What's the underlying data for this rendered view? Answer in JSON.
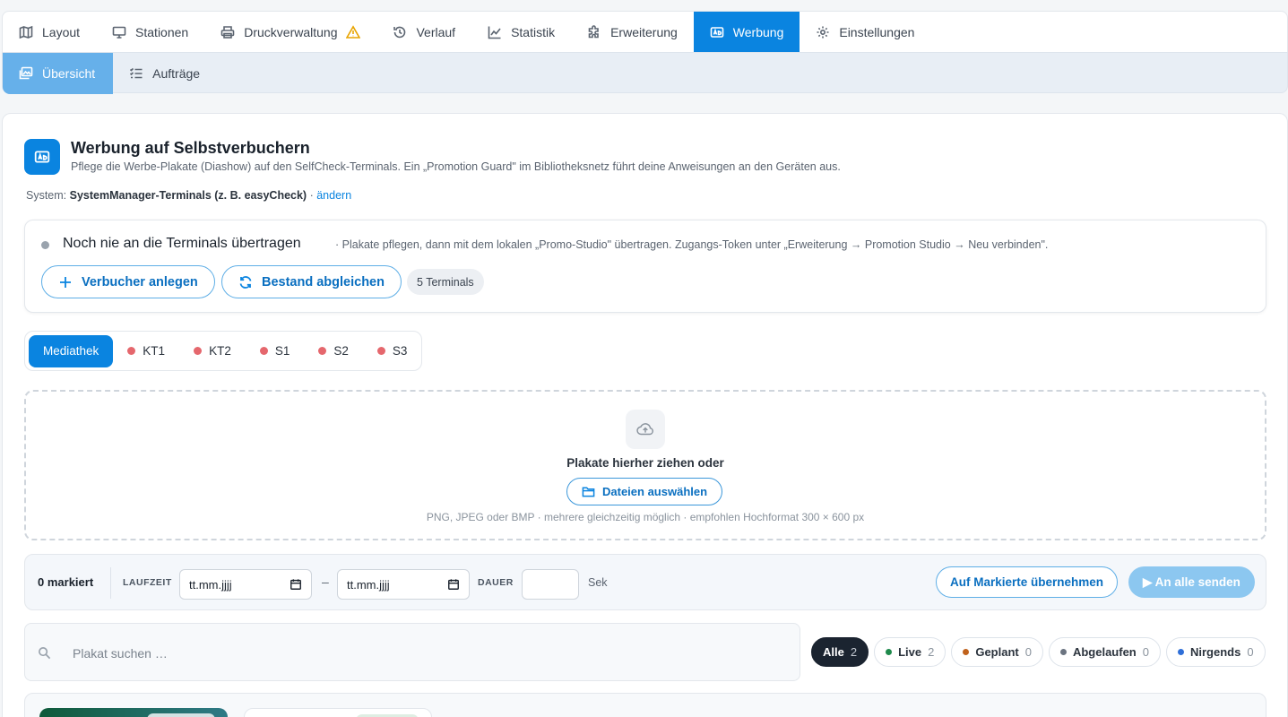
{
  "topnav": {
    "tabs": [
      {
        "label": "Layout",
        "icon": "map-icon"
      },
      {
        "label": "Stationen",
        "icon": "monitor-icon"
      },
      {
        "label": "Druckverwaltung",
        "icon": "printer-icon"
      },
      {
        "label": "Verlauf",
        "icon": "history-icon"
      },
      {
        "label": "Statistik",
        "icon": "chart-line-icon"
      },
      {
        "label": "Erweiterung",
        "icon": "puzzle-icon"
      },
      {
        "label": "Werbung",
        "icon": "ad-icon"
      },
      {
        "label": "Einstellungen",
        "icon": "gear-icon"
      }
    ],
    "active": "Werbung"
  },
  "subnav": {
    "tabs": [
      {
        "label": "Übersicht",
        "icon": "images-icon"
      },
      {
        "label": "Aufträge",
        "icon": "checklist-icon"
      }
    ],
    "active": "Übersicht"
  },
  "header": {
    "title": "Werbung auf Selbstverbuchern",
    "description": "Pflege die Werbe-Plakate (Diashow) auf den SelfCheck-Terminals. Ein „Promotion Guard\" im Bibliotheksnetz führt deine Anweisungen an den Geräten aus.",
    "system_label": "System:",
    "system_value": "SystemManager-Terminals (z. B. easyCheck)",
    "system_sep": "·",
    "change_link": "ändern"
  },
  "status": {
    "title": "Noch nie an die Terminals übertragen",
    "hint": "· Plakate pflegen, dann mit dem lokalen „Promo-Studio\" übertragen. Zugangs-Token unter „Erweiterung → Promotion Studio → Neu verbinden\".",
    "btn_add": "Verbucher anlegen",
    "btn_sync": "Bestand abgleichen",
    "terminal_count": "5 Terminals"
  },
  "segments": [
    {
      "label": "Mediathek",
      "active": true
    },
    {
      "label": "KT1",
      "status_color": "#e5676d"
    },
    {
      "label": "KT2",
      "status_color": "#e5676d"
    },
    {
      "label": "S1",
      "status_color": "#e5676d"
    },
    {
      "label": "S2",
      "status_color": "#e5676d"
    },
    {
      "label": "S3",
      "status_color": "#e5676d"
    }
  ],
  "dropzone": {
    "title": "Plakate hierher ziehen oder",
    "button": "Dateien auswählen",
    "hint": "PNG, JPEG oder BMP · mehrere gleichzeitig möglich · empfohlen Hochformat 300 × 600 px"
  },
  "bulk": {
    "marked": "0 markiert",
    "runtime_label": "LAUFZEIT",
    "date_from_placeholder": "tt.mm.jjjj",
    "date_sep": "–",
    "date_to_placeholder": "tt.mm.jjjj",
    "duration_label": "DAUER",
    "duration_value": "",
    "duration_unit": "Sek",
    "btn_apply": "Auf Markierte übernehmen",
    "btn_send": "▶ An alle senden"
  },
  "search": {
    "placeholder": "Plakat suchen …"
  },
  "filters": [
    {
      "label": "Alle",
      "count": "2",
      "active": true
    },
    {
      "label": "Live",
      "count": "2",
      "color": "#1f8a4c"
    },
    {
      "label": "Geplant",
      "count": "0",
      "color": "#c0621c"
    },
    {
      "label": "Abgelaufen",
      "count": "0",
      "color": "#6b7480"
    },
    {
      "label": "Nirgends",
      "count": "0",
      "color": "#2f6fd8"
    }
  ],
  "colors": {
    "accent": "#0a84e0",
    "subnav_active": "#66b0ea",
    "offline_dot": "#e5676d"
  }
}
